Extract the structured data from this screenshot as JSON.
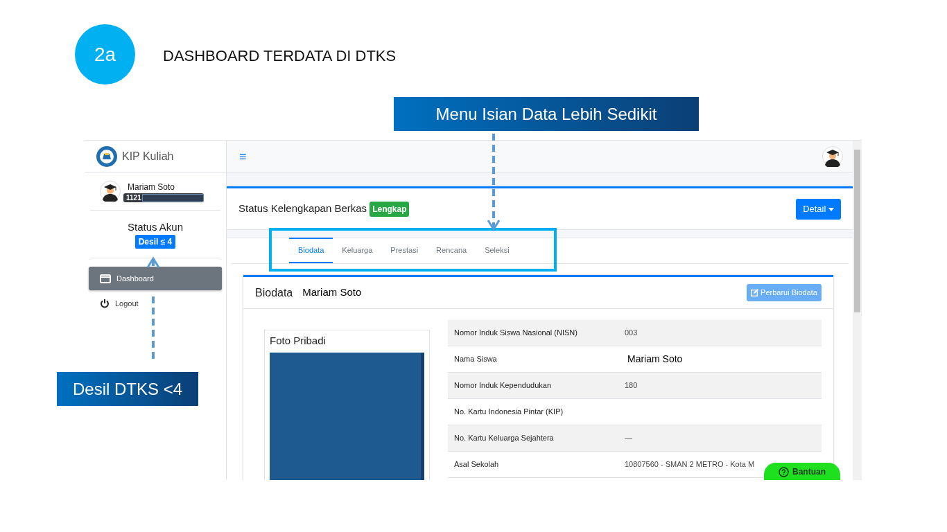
{
  "slide": {
    "step": "2a",
    "title": "DASHBOARD TERDATA DI DTKS",
    "callouts": [
      {
        "text": "Menu Isian Data Lebih Sedikit"
      },
      {
        "text": "Desil DTKS <4"
      }
    ]
  },
  "app": {
    "brand": "KIP Kuliah",
    "user": {
      "name": "Mariam Soto",
      "id": "1121"
    },
    "status": {
      "title": "Status Akun",
      "badge": "Desil ≤ 4"
    },
    "menu": [
      {
        "label": "Dashboard",
        "kind": "dashboard",
        "selected": true
      },
      {
        "label": "Logout",
        "kind": "logout",
        "selected": false
      }
    ],
    "topbar": {
      "menu_icon": "≡"
    },
    "berkas": {
      "label": "Status Kelengkapan Berkas",
      "badge": "Lengkap",
      "button": "Detail"
    },
    "tabs": [
      {
        "label": "Biodata",
        "selected": true
      },
      {
        "label": "Keluarga",
        "selected": false
      },
      {
        "label": "Prestasi",
        "selected": false
      },
      {
        "label": "Rencana",
        "selected": false
      },
      {
        "label": "Seleksi",
        "selected": false
      }
    ],
    "biodata": {
      "title": "Biodata",
      "name": "Mariam Soto",
      "button": "Perbarui Biodata",
      "photo_title": "Foto Pribadi",
      "rows": [
        {
          "label": "Nomor Induk Siswa Nasional (NISN)",
          "value": "003"
        },
        {
          "label": "Nama Siswa",
          "value": "Mariam Soto",
          "kind": "large"
        },
        {
          "label": "Nomor Induk Kependudukan",
          "value": "180"
        },
        {
          "label": "No. Kartu Indonesia Pintar (KIP)"
        },
        {
          "label": "No. Kartu Keluarga Sejahtera",
          "value": "—"
        },
        {
          "label": "Asal Sekolah",
          "value": "10807560 - SMAN 2 METRO - Kota M"
        }
      ]
    },
    "help": "Bantuan"
  }
}
